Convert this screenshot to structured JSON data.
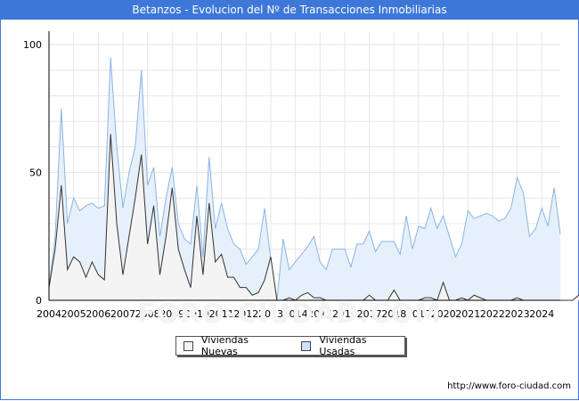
{
  "title": "Betanzos - Evolucion del Nº de Transacciones Inmobiliarias",
  "source": "http://www.foro-ciudad.com",
  "watermark": "FORO-CIUDAD.COM",
  "chart_data": {
    "type": "area",
    "title": "Betanzos - Evolucion del Nº de Transacciones Inmobiliarias",
    "xlabel": "",
    "ylabel": "",
    "x_start": 2004,
    "x_step": 0.25,
    "xlim": [
      2004,
      2024.75
    ],
    "ylim": [
      0,
      100
    ],
    "y_ticks": [
      0,
      50,
      100
    ],
    "x_ticks": [
      "2004",
      "2005",
      "2006",
      "2007",
      "2008",
      "2009",
      "2010",
      "2011",
      "2012",
      "2013",
      "2014",
      "2015",
      "2016",
      "2017",
      "2018",
      "2019",
      "2020",
      "2021",
      "2022",
      "2023",
      "2024"
    ],
    "grid": true,
    "legend_position": "bottom",
    "series": [
      {
        "name": "Viviendas Nuevas",
        "fill": "#f4f4f4",
        "stroke": "#333333",
        "values": [
          5,
          20,
          45,
          12,
          17,
          15,
          9,
          15,
          10,
          8,
          65,
          30,
          10,
          25,
          40,
          57,
          22,
          37,
          10,
          25,
          44,
          20,
          12,
          5,
          33,
          10,
          38,
          15,
          18,
          9,
          9,
          5,
          5,
          2,
          3,
          8,
          17,
          0,
          0,
          1,
          0,
          2,
          3,
          1,
          1,
          0,
          0,
          0,
          0,
          0,
          0,
          0,
          2,
          0,
          0,
          0,
          4,
          0,
          0,
          0,
          0,
          1,
          1,
          0,
          7,
          0,
          0,
          1,
          0,
          2,
          1,
          0,
          0,
          0,
          0,
          0,
          1,
          0,
          0,
          0,
          0,
          0,
          0,
          0,
          0,
          0,
          2,
          1,
          1,
          0,
          2,
          0
        ]
      },
      {
        "name": "Viviendas Usadas",
        "fill": "#e6f0fb",
        "stroke": "#8ab4e6",
        "values": [
          5,
          25,
          75,
          30,
          40,
          35,
          37,
          38,
          36,
          37,
          95,
          60,
          36,
          50,
          60,
          90,
          45,
          52,
          25,
          40,
          52,
          30,
          24,
          22,
          45,
          17,
          56,
          28,
          38,
          28,
          22,
          20,
          14,
          17,
          20,
          36,
          16,
          0,
          24,
          12,
          15,
          18,
          21,
          25,
          15,
          12,
          20,
          20,
          20,
          13,
          22,
          22,
          27,
          19,
          23,
          23,
          23,
          18,
          33,
          20,
          29,
          28,
          36,
          28,
          33,
          25,
          17,
          22,
          35,
          32,
          33,
          34,
          33,
          31,
          32,
          36,
          48,
          42,
          25,
          28,
          36,
          29,
          44,
          26
        ]
      }
    ]
  }
}
